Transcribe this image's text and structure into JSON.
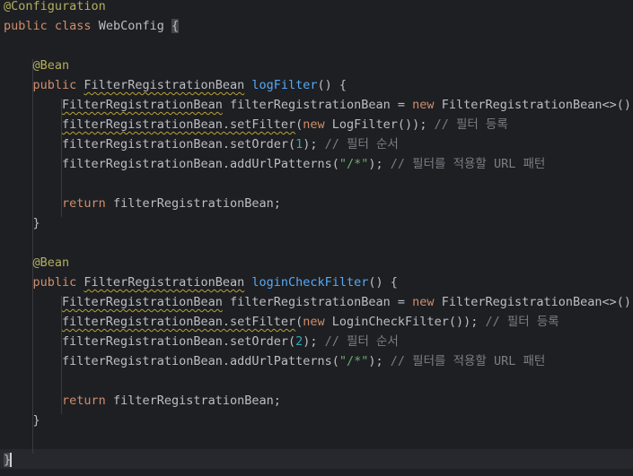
{
  "editor": {
    "lines": [
      {
        "id": "l1",
        "tokens": [
          {
            "t": "@Configuration",
            "c": "annotation"
          }
        ]
      },
      {
        "id": "l2",
        "tokens": [
          {
            "t": "public ",
            "c": "kw"
          },
          {
            "t": "class ",
            "c": "kw"
          },
          {
            "t": "WebConfig ",
            "c": "type"
          },
          {
            "t": "{",
            "c": "brace-hl"
          }
        ]
      },
      {
        "id": "l3",
        "tokens": []
      },
      {
        "id": "l4",
        "tokens": [
          {
            "t": "    "
          },
          {
            "t": "@Bean",
            "c": "annotation"
          }
        ]
      },
      {
        "id": "l5",
        "tokens": [
          {
            "t": "    "
          },
          {
            "t": "public ",
            "c": "kw"
          },
          {
            "t": "FilterRegistrationBean",
            "c": "type warn"
          },
          {
            "t": " "
          },
          {
            "t": "logFilter",
            "c": "fn"
          },
          {
            "t": "() {"
          }
        ]
      },
      {
        "id": "l6",
        "tokens": [
          {
            "t": "        "
          },
          {
            "t": "FilterRegistrationBean",
            "c": "type warn"
          },
          {
            "t": " filterRegistrationBean = "
          },
          {
            "t": "new ",
            "c": "kw"
          },
          {
            "t": "FilterRegistrationBean<>();"
          }
        ]
      },
      {
        "id": "l7",
        "tokens": [
          {
            "t": "        "
          },
          {
            "t": "filterRegistrationBean.setFilter",
            "c": "warn"
          },
          {
            "t": "("
          },
          {
            "t": "new ",
            "c": "kw"
          },
          {
            "t": "LogFilter()); "
          },
          {
            "t": "// 필터 등록",
            "c": "comment"
          }
        ]
      },
      {
        "id": "l8",
        "tokens": [
          {
            "t": "        "
          },
          {
            "t": "filterRegistrationBean.setOrder("
          },
          {
            "t": "1",
            "c": "num"
          },
          {
            "t": "); "
          },
          {
            "t": "// 필터 순서",
            "c": "comment"
          }
        ]
      },
      {
        "id": "l9",
        "tokens": [
          {
            "t": "        "
          },
          {
            "t": "filterRegistrationBean.addUrlPatterns("
          },
          {
            "t": "\"/*\"",
            "c": "str"
          },
          {
            "t": "); "
          },
          {
            "t": "// 필터를 적용할 URL 패턴",
            "c": "comment"
          }
        ]
      },
      {
        "id": "l10",
        "tokens": []
      },
      {
        "id": "l11",
        "tokens": [
          {
            "t": "        "
          },
          {
            "t": "return ",
            "c": "kw"
          },
          {
            "t": "filterRegistrationBean;"
          }
        ]
      },
      {
        "id": "l12",
        "tokens": [
          {
            "t": "    }"
          }
        ]
      },
      {
        "id": "l13",
        "tokens": []
      },
      {
        "id": "l14",
        "tokens": [
          {
            "t": "    "
          },
          {
            "t": "@Bean",
            "c": "annotation"
          }
        ]
      },
      {
        "id": "l15",
        "tokens": [
          {
            "t": "    "
          },
          {
            "t": "public ",
            "c": "kw"
          },
          {
            "t": "FilterRegistrationBean",
            "c": "type warn"
          },
          {
            "t": " "
          },
          {
            "t": "loginCheckFilter",
            "c": "fn"
          },
          {
            "t": "() {"
          }
        ]
      },
      {
        "id": "l16",
        "tokens": [
          {
            "t": "        "
          },
          {
            "t": "FilterRegistrationBean",
            "c": "type warn"
          },
          {
            "t": " filterRegistrationBean = "
          },
          {
            "t": "new ",
            "c": "kw"
          },
          {
            "t": "FilterRegistrationBean<>();"
          }
        ]
      },
      {
        "id": "l17",
        "tokens": [
          {
            "t": "        "
          },
          {
            "t": "filterRegistrationBean.setFilter",
            "c": "warn"
          },
          {
            "t": "("
          },
          {
            "t": "new ",
            "c": "kw"
          },
          {
            "t": "LoginCheckFilter()); "
          },
          {
            "t": "// 필터 등록",
            "c": "comment"
          }
        ]
      },
      {
        "id": "l18",
        "tokens": [
          {
            "t": "        "
          },
          {
            "t": "filterRegistrationBean.setOrder("
          },
          {
            "t": "2",
            "c": "num"
          },
          {
            "t": "); "
          },
          {
            "t": "// 필터 순서",
            "c": "comment"
          }
        ]
      },
      {
        "id": "l19",
        "tokens": [
          {
            "t": "        "
          },
          {
            "t": "filterRegistrationBean.addUrlPatterns("
          },
          {
            "t": "\"/*\"",
            "c": "str"
          },
          {
            "t": "); "
          },
          {
            "t": "// 필터를 적용할 URL 패턴",
            "c": "comment"
          }
        ]
      },
      {
        "id": "l20",
        "tokens": []
      },
      {
        "id": "l21",
        "tokens": [
          {
            "t": "        "
          },
          {
            "t": "return ",
            "c": "kw"
          },
          {
            "t": "filterRegistrationBean;"
          }
        ]
      },
      {
        "id": "l22",
        "tokens": [
          {
            "t": "    }"
          }
        ]
      },
      {
        "id": "l23",
        "tokens": []
      },
      {
        "id": "l24",
        "tokens": [
          {
            "t": "}",
            "c": "brace-hl"
          }
        ]
      }
    ]
  }
}
